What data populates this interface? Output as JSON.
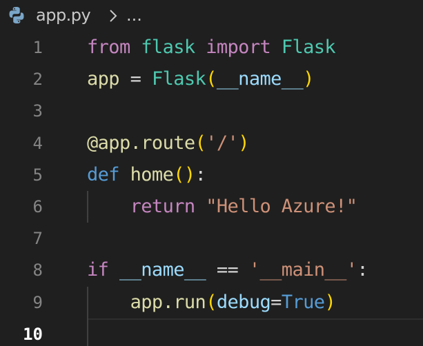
{
  "breadcrumb": {
    "file_icon": "python-icon",
    "file": "app.py",
    "separator_icon": "chevron-right-icon",
    "more": "..."
  },
  "editor": {
    "active_line": 10,
    "lines": [
      {
        "number": "1",
        "tokens": [
          {
            "t": "from",
            "c": "kw-ctrl"
          },
          {
            "t": " ",
            "c": "plain"
          },
          {
            "t": "flask",
            "c": "mod"
          },
          {
            "t": " ",
            "c": "plain"
          },
          {
            "t": "import",
            "c": "kw-ctrl"
          },
          {
            "t": " ",
            "c": "plain"
          },
          {
            "t": "Flask",
            "c": "cls"
          }
        ]
      },
      {
        "number": "2",
        "tokens": [
          {
            "t": "app",
            "c": "fn"
          },
          {
            "t": " = ",
            "c": "plain"
          },
          {
            "t": "Flask",
            "c": "cls"
          },
          {
            "t": "(",
            "c": "br1"
          },
          {
            "t": "__name__",
            "c": "var"
          },
          {
            "t": ")",
            "c": "br1"
          }
        ]
      },
      {
        "number": "3",
        "tokens": []
      },
      {
        "number": "4",
        "tokens": [
          {
            "t": "@app.route",
            "c": "dec"
          },
          {
            "t": "(",
            "c": "br1"
          },
          {
            "t": "'/'",
            "c": "str"
          },
          {
            "t": ")",
            "c": "br1"
          }
        ]
      },
      {
        "number": "5",
        "tokens": [
          {
            "t": "def",
            "c": "kw"
          },
          {
            "t": " ",
            "c": "plain"
          },
          {
            "t": "home",
            "c": "fn"
          },
          {
            "t": "()",
            "c": "br1"
          },
          {
            "t": ":",
            "c": "plain"
          }
        ]
      },
      {
        "number": "6",
        "indent": true,
        "tokens": [
          {
            "t": "    ",
            "c": "plain"
          },
          {
            "t": "return",
            "c": "kw-ctrl"
          },
          {
            "t": " ",
            "c": "plain"
          },
          {
            "t": "\"Hello Azure!\"",
            "c": "str"
          }
        ]
      },
      {
        "number": "7",
        "tokens": []
      },
      {
        "number": "8",
        "tokens": [
          {
            "t": "if",
            "c": "kw-ctrl"
          },
          {
            "t": " ",
            "c": "plain"
          },
          {
            "t": "__name__",
            "c": "var"
          },
          {
            "t": " == ",
            "c": "plain"
          },
          {
            "t": "'__main__'",
            "c": "str"
          },
          {
            "t": ":",
            "c": "plain"
          }
        ]
      },
      {
        "number": "9",
        "indent": true,
        "tokens": [
          {
            "t": "    ",
            "c": "plain"
          },
          {
            "t": "app.run",
            "c": "fn"
          },
          {
            "t": "(",
            "c": "br1"
          },
          {
            "t": "debug",
            "c": "var"
          },
          {
            "t": "=",
            "c": "plain"
          },
          {
            "t": "True",
            "c": "kw"
          },
          {
            "t": ")",
            "c": "br1"
          }
        ]
      },
      {
        "number": "10",
        "indent": true,
        "tokens": []
      }
    ]
  },
  "colors": {
    "background": "#1f1f1f",
    "keyword_control": "#c586c0",
    "keyword": "#569cd6",
    "class": "#4ec9b0",
    "variable": "#9cdcfe",
    "function": "#dcdcaa",
    "string": "#ce9178",
    "bracket": "#ffd700"
  }
}
